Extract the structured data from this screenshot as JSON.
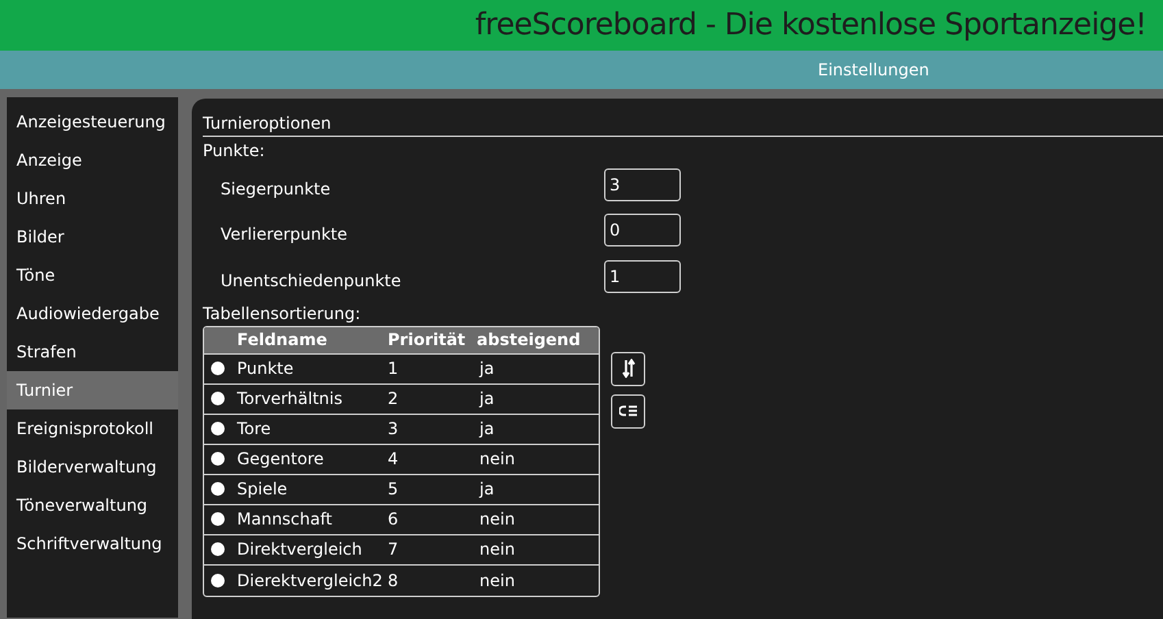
{
  "header": {
    "title": "freeScoreboard - Die kostenlose Sportanzeige!"
  },
  "subheader": {
    "title": "Einstellungen"
  },
  "sidebar": {
    "items": [
      {
        "label": "Anzeigesteuerung",
        "selected": false
      },
      {
        "label": "Anzeige",
        "selected": false
      },
      {
        "label": "Uhren",
        "selected": false
      },
      {
        "label": "Bilder",
        "selected": false
      },
      {
        "label": "Töne",
        "selected": false
      },
      {
        "label": "Audiowiedergabe",
        "selected": false
      },
      {
        "label": "Strafen",
        "selected": false
      },
      {
        "label": "Turnier",
        "selected": true
      },
      {
        "label": "Ereignisprotokoll",
        "selected": false
      },
      {
        "label": "Bilderverwaltung",
        "selected": false
      },
      {
        "label": "Töneverwaltung",
        "selected": false
      },
      {
        "label": "Schriftverwaltung",
        "selected": false
      }
    ]
  },
  "panel": {
    "title": "Turnieroptionen",
    "points_label": "Punkte:",
    "fields": [
      {
        "label": "Siegerpunkte",
        "value": "3"
      },
      {
        "label": "Verliererpunkte",
        "value": "0"
      },
      {
        "label": "Unentschiedenpunkte",
        "value": "1"
      }
    ],
    "sorting_label": "Tabellensortierung:",
    "table": {
      "columns": [
        "Feldname",
        "Priorität",
        "absteigend"
      ],
      "rows": [
        {
          "name": "Punkte",
          "priority": "1",
          "descending": "ja",
          "selected": false
        },
        {
          "name": "Torverhältnis",
          "priority": "2",
          "descending": "ja",
          "selected": false
        },
        {
          "name": "Tore",
          "priority": "3",
          "descending": "ja",
          "selected": false
        },
        {
          "name": "Gegentore",
          "priority": "4",
          "descending": "nein",
          "selected": false
        },
        {
          "name": "Spiele",
          "priority": "5",
          "descending": "ja",
          "selected": false
        },
        {
          "name": "Mannschaft",
          "priority": "6",
          "descending": "nein",
          "selected": false
        },
        {
          "name": "Direktvergleich",
          "priority": "7",
          "descending": "nein",
          "selected": false
        },
        {
          "name": "Dierektvergleich2",
          "priority": "8",
          "descending": "nein",
          "selected": false
        }
      ]
    }
  }
}
